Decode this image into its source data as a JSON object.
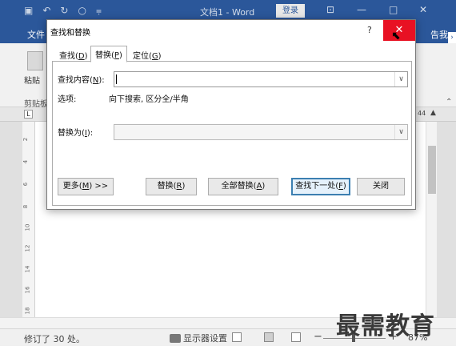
{
  "window": {
    "title": "文档1 - Word",
    "login_label": "登录",
    "ribbon_display_icon": "ribbon-display-icon",
    "minimize_glyph": "—",
    "restore_glyph": "□",
    "close_glyph": "✕"
  },
  "ribbon": {
    "file_tab": "文件",
    "right_tab_partial": "告我",
    "paste_label": "粘贴",
    "clipboard_group": "剪贴板"
  },
  "ruler": {
    "right_number": "44"
  },
  "vertical_ruler": [
    "2",
    "4",
    "6",
    "8",
    "10",
    "12",
    "14",
    "16",
    "18"
  ],
  "dialog": {
    "title": "查找和替换",
    "help": "?",
    "tabs": [
      {
        "label": "查找(D)",
        "text": "查找(",
        "key": "D",
        "tail": ")"
      },
      {
        "label": "替换(P)",
        "text": "替换(",
        "key": "P",
        "tail": ")"
      },
      {
        "label": "定位(G)",
        "text": "定位(",
        "key": "G",
        "tail": ")"
      }
    ],
    "active_tab": "替换(P)",
    "find": {
      "label": "查找内容(",
      "key": "N",
      "tail": "):",
      "value": ""
    },
    "options": {
      "label": "选项:",
      "value": "向下搜索, 区分全/半角"
    },
    "replace": {
      "label": "替换为(",
      "key": "I",
      "tail": "):",
      "value": ""
    },
    "buttons": {
      "more": {
        "text": "更多(",
        "key": "M",
        "tail": ") >>"
      },
      "replace": {
        "text": "替换(",
        "key": "R",
        "tail": ")"
      },
      "replace_all": {
        "text": "全部替换(",
        "key": "A",
        "tail": ")"
      },
      "find_next": {
        "text": "查找下一处(",
        "key": "F",
        "tail": ")"
      },
      "close": "关闭"
    }
  },
  "status": {
    "revisions": "修订了 30 处。",
    "display_settings": "显示器设置",
    "zoom_minus": "−",
    "zoom_plus": "+",
    "zoom": "87%",
    "zoom_fraction": 0.47
  },
  "watermark": "最需教育"
}
